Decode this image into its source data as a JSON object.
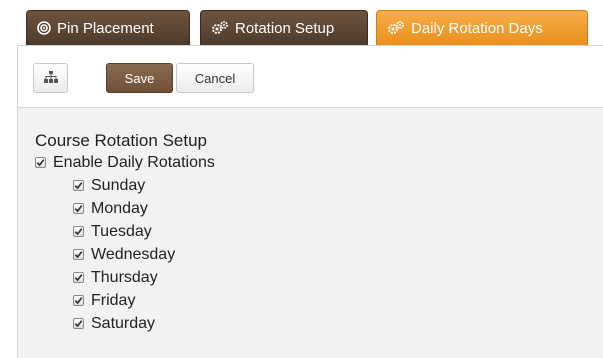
{
  "tabs": [
    {
      "label": "Pin Placement",
      "icon": "target-icon",
      "active": false
    },
    {
      "label": "Rotation Setup",
      "icon": "gears-icon",
      "active": false
    },
    {
      "label": "Daily Rotation Days",
      "icon": "gears-icon",
      "active": true
    }
  ],
  "toolbar": {
    "tree_icon": "sitemap-icon",
    "save_label": "Save",
    "cancel_label": "Cancel"
  },
  "section": {
    "title": "Course Rotation Setup",
    "enable": {
      "label": "Enable Daily Rotations",
      "checked": true
    },
    "days": [
      {
        "label": "Sunday",
        "checked": true
      },
      {
        "label": "Monday",
        "checked": true
      },
      {
        "label": "Tuesday",
        "checked": true
      },
      {
        "label": "Wednesday",
        "checked": true
      },
      {
        "label": "Thursday",
        "checked": true
      },
      {
        "label": "Friday",
        "checked": true
      },
      {
        "label": "Saturday",
        "checked": true
      }
    ]
  },
  "colors": {
    "tab_dark": "#5a4231",
    "tab_active": "#f0a030",
    "save_button": "#7a5c42",
    "panel_bg": "#f2f2f2"
  }
}
